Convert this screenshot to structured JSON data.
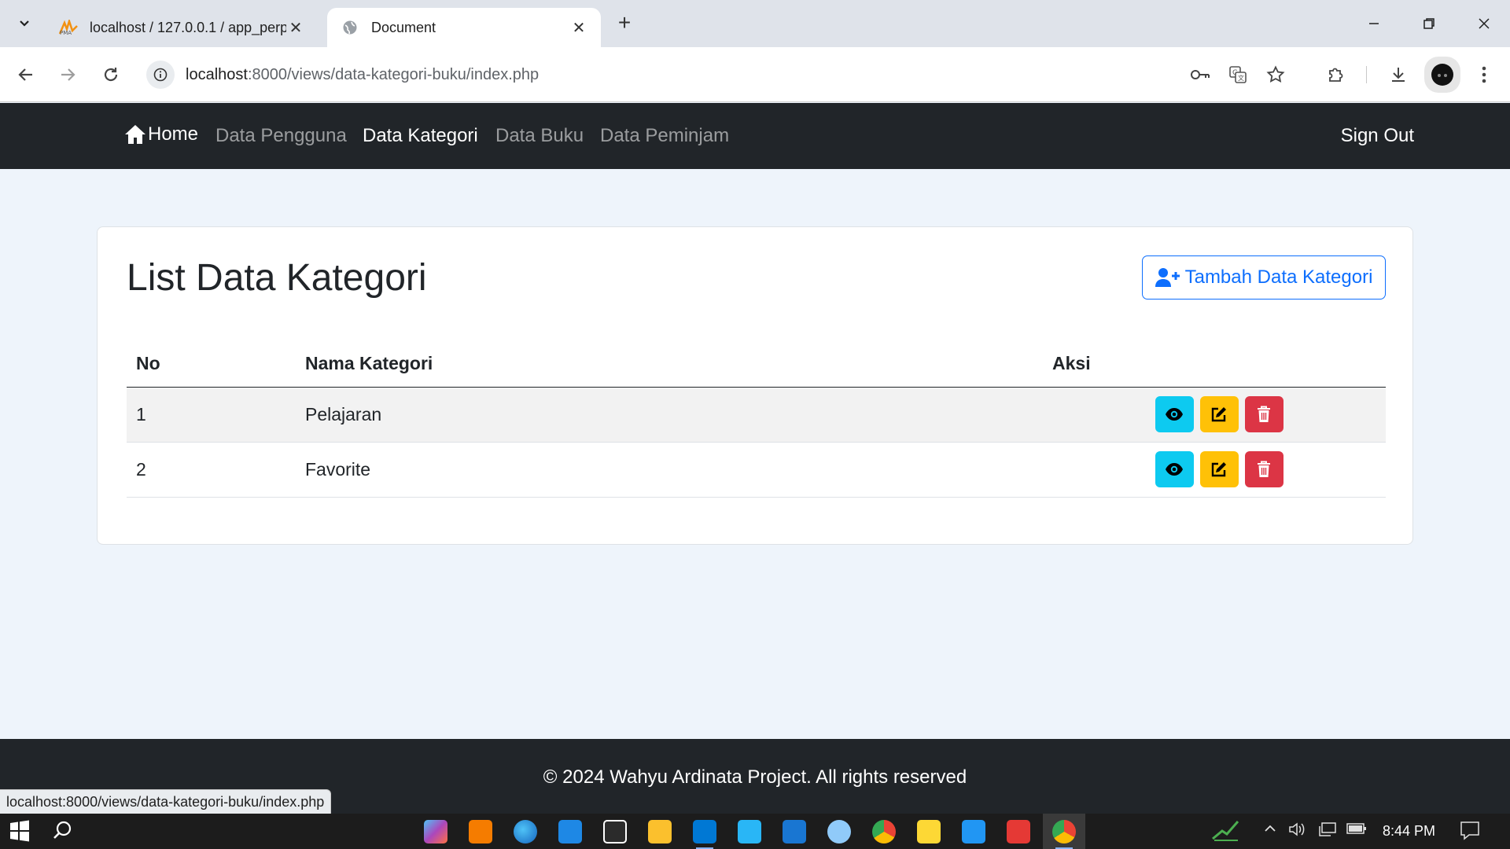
{
  "browser": {
    "tabs": [
      {
        "title": "localhost / 127.0.0.1 / app_perp",
        "favicon": "phpmyadmin-icon",
        "active": false
      },
      {
        "title": "Document",
        "favicon": "globe-icon",
        "active": true
      }
    ],
    "address": {
      "host": "localhost",
      "path": ":8000/views/data-kategori-buku/index.php"
    },
    "status_url": "localhost:8000/views/data-kategori-buku/index.php"
  },
  "navbar": {
    "home": "Home",
    "links": [
      "Data Pengguna",
      "Data Kategori",
      "Data Buku",
      "Data Peminjam"
    ],
    "active_link": "Data Kategori",
    "signout": "Sign Out"
  },
  "card": {
    "title": "List Data Kategori",
    "add_button": "Tambah Data Kategori"
  },
  "table": {
    "headers": {
      "no": "No",
      "name": "Nama Kategori",
      "action": "Aksi"
    },
    "rows": [
      {
        "no": "1",
        "name": "Pelajaran"
      },
      {
        "no": "2",
        "name": "Favorite"
      }
    ]
  },
  "footer": {
    "text": "© 2024 Wahyu Ardinata Project. All rights reserved"
  },
  "taskbar": {
    "time": "8:44 PM"
  },
  "colors": {
    "navbar_bg": "#212529",
    "primary": "#0d6efd",
    "info": "#0dcaf0",
    "warning": "#ffc107",
    "danger": "#dc3545",
    "page_bg": "#eef4fb"
  }
}
